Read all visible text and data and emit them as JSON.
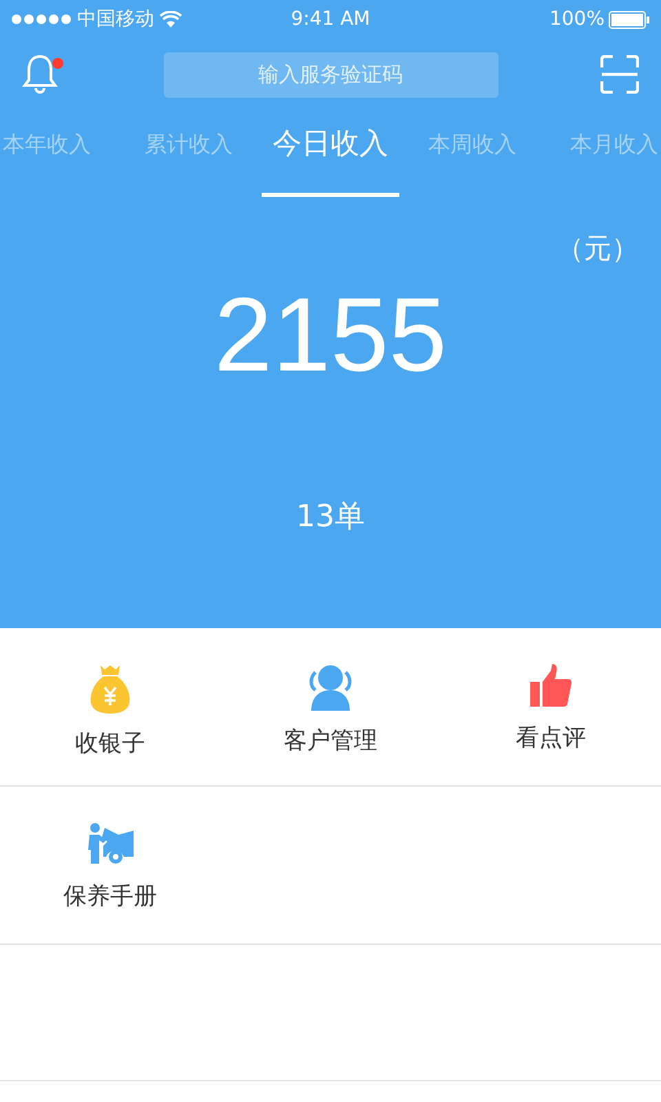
{
  "status_bar": {
    "carrier": "中国移动",
    "time": "9:41 AM",
    "battery": "100%"
  },
  "header": {
    "notification_unread": true,
    "search": {
      "placeholder": "输入服务验证码"
    }
  },
  "tabs": [
    {
      "label": "本年收入",
      "selected": false
    },
    {
      "label": "累计收入",
      "selected": false
    },
    {
      "label": "今日收入",
      "selected": true
    },
    {
      "label": "本周收入",
      "selected": false
    },
    {
      "label": "本月收入",
      "selected": false
    }
  ],
  "summary": {
    "unit": "（元）",
    "amount": "2155",
    "orders": "13单"
  },
  "menu": [
    {
      "label": "收银子",
      "kind": "money"
    },
    {
      "label": "客户管理",
      "kind": "customers"
    },
    {
      "label": "看点评",
      "kind": "reviews"
    },
    {
      "label": "保养手册",
      "kind": "maintenance"
    }
  ]
}
